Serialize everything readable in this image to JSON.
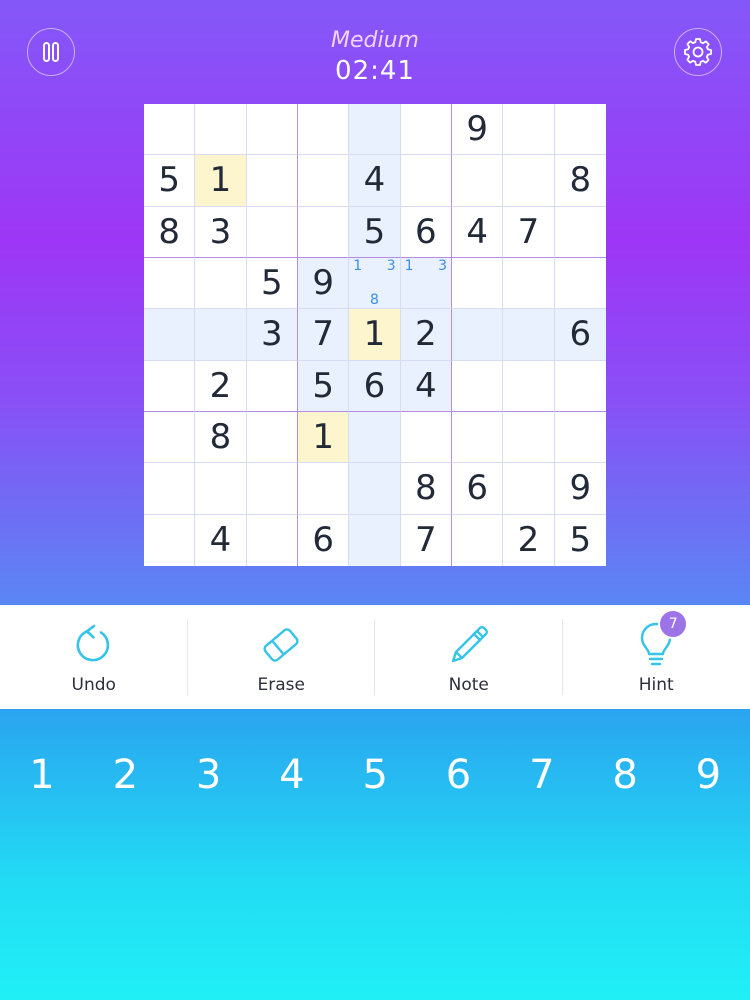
{
  "header": {
    "difficulty": "Medium",
    "timer": "02:41",
    "pause_icon": "pause-icon",
    "settings_icon": "gear-icon"
  },
  "colors": {
    "top_gradient": [
      "#8458f8",
      "#9d36f6",
      "#5a86f4"
    ],
    "bottom_gradient": [
      "#2aa4f0",
      "#20f0f6"
    ],
    "selected_cell": "#fdf5cd",
    "highlight_cell": "#e8f1fd",
    "note_color": "#3a8fe8",
    "hint_badge": "#9d74e8"
  },
  "board": {
    "selected": [
      4,
      4
    ],
    "grid": [
      [
        "",
        "",
        "",
        "",
        "",
        "",
        "9",
        "",
        ""
      ],
      [
        "5",
        "1",
        "",
        "",
        "4",
        "",
        "",
        "",
        "8"
      ],
      [
        "8",
        "3",
        "",
        "",
        "5",
        "6",
        "4",
        "7",
        ""
      ],
      [
        "",
        "",
        "5",
        "9",
        "",
        "",
        "",
        "",
        ""
      ],
      [
        "",
        "",
        "3",
        "7",
        "1",
        "2",
        "",
        "",
        "6"
      ],
      [
        "",
        "2",
        "",
        "5",
        "6",
        "4",
        "",
        "",
        ""
      ],
      [
        "",
        "8",
        "",
        "1",
        "",
        "",
        "",
        "",
        ""
      ],
      [
        "",
        "",
        "",
        "",
        "",
        "8",
        "6",
        "",
        "9"
      ],
      [
        "",
        "4",
        "",
        "6",
        "",
        "7",
        "",
        "2",
        "5"
      ]
    ],
    "notes": [
      {
        "row": 3,
        "col": 4,
        "digits": [
          "1",
          "",
          "3",
          "",
          "",
          "",
          "",
          "8",
          ""
        ]
      },
      {
        "row": 3,
        "col": 5,
        "digits": [
          "1",
          "",
          "3",
          "",
          "",
          "",
          "",
          "",
          ""
        ]
      }
    ]
  },
  "toolbar": {
    "undo": {
      "label": "Undo",
      "icon": "undo-icon"
    },
    "erase": {
      "label": "Erase",
      "icon": "eraser-icon"
    },
    "note": {
      "label": "Note",
      "icon": "pencil-icon"
    },
    "hint": {
      "label": "Hint",
      "icon": "lightbulb-icon",
      "badge": "7"
    }
  },
  "numpad": [
    "1",
    "2",
    "3",
    "4",
    "5",
    "6",
    "7",
    "8",
    "9"
  ]
}
